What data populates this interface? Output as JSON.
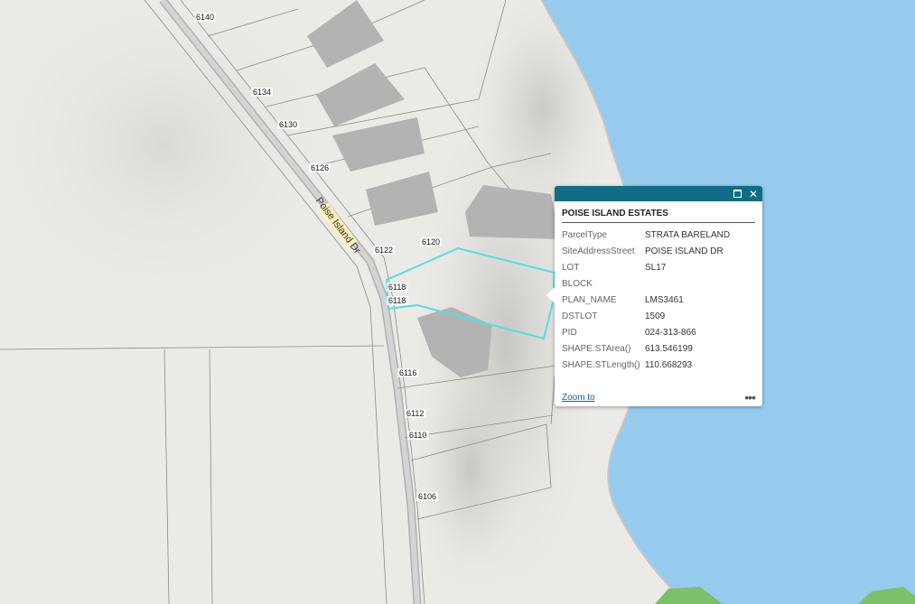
{
  "map": {
    "road_name": "Poise Island Dr",
    "addresses": [
      "6140",
      "6134",
      "6130",
      "6126",
      "6122",
      "6120",
      "6118",
      "6118",
      "6116",
      "6112",
      "6110",
      "6106"
    ],
    "colors": {
      "water": "#97cbee",
      "land": "#ebeae6",
      "highlight": "#4fe0e6",
      "park": "#7cc06a"
    }
  },
  "popup": {
    "title": "POISE ISLAND ESTATES",
    "maximize_icon": "maximize-icon",
    "close_icon": "close-icon",
    "attributes": [
      {
        "key": "ParcelType",
        "value": "STRATA BARELAND"
      },
      {
        "key": "SiteAddressStreet",
        "value": "POISE ISLAND DR"
      },
      {
        "key": "LOT",
        "value": "SL17"
      },
      {
        "key": "BLOCK",
        "value": ""
      },
      {
        "key": "PLAN_NAME",
        "value": "LMS3461"
      },
      {
        "key": "DSTLOT",
        "value": "1509"
      },
      {
        "key": "PID",
        "value": "024-313-866"
      },
      {
        "key": "SHAPE.STArea()",
        "value": "613.546199"
      },
      {
        "key": "SHAPE.STLength()",
        "value": "110.668293"
      }
    ],
    "zoom_label": "Zoom to",
    "more_label": "•••",
    "header_color": "#0f6e85"
  }
}
